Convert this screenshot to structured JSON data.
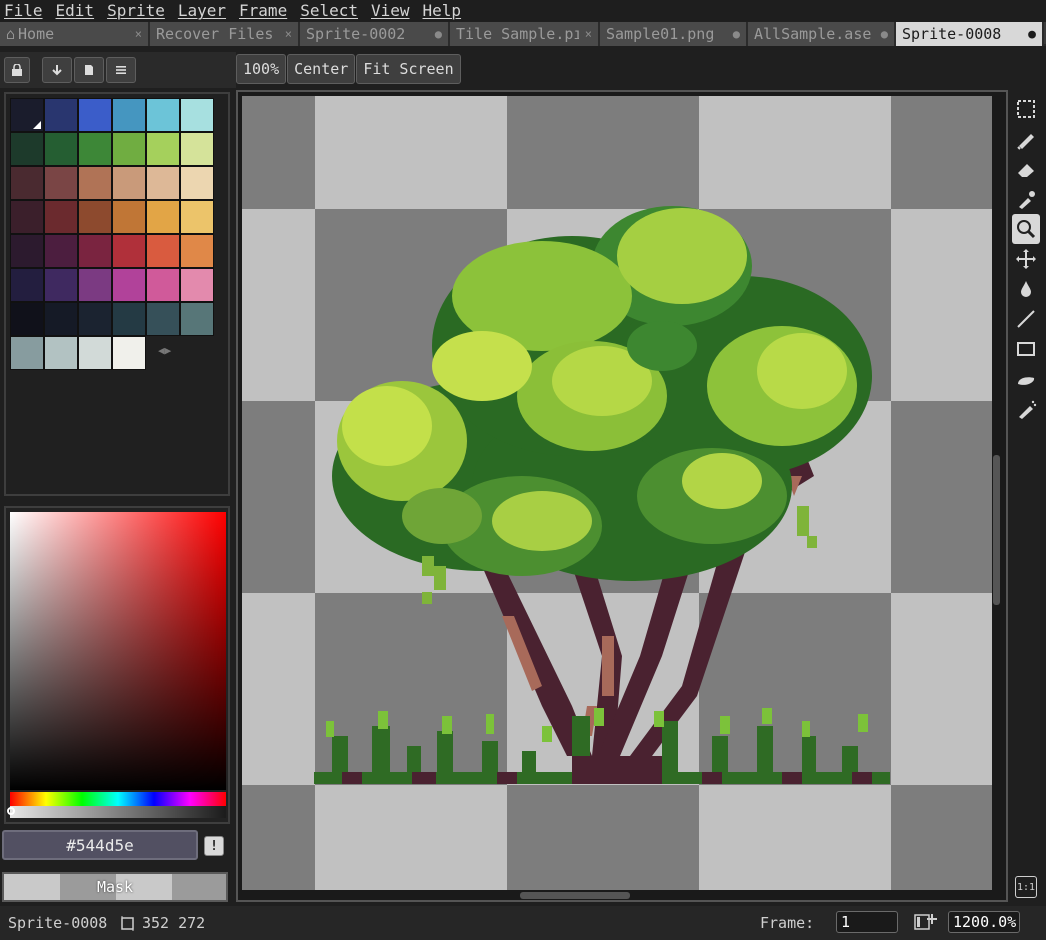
{
  "menu": [
    "File",
    "Edit",
    "Sprite",
    "Layer",
    "Frame",
    "Select",
    "View",
    "Help"
  ],
  "tabs": [
    {
      "label": "Home",
      "mark": "×",
      "width": 150
    },
    {
      "label": "Recover Files",
      "mark": "×",
      "width": 150
    },
    {
      "label": "Sprite-0002",
      "mark": "●",
      "width": 150
    },
    {
      "label": "Tile Sample.pı",
      "mark": "×",
      "width": 150
    },
    {
      "label": "Sample01.png",
      "mark": "●",
      "width": 148
    },
    {
      "label": "AllSample.ase",
      "mark": "●",
      "width": 148
    },
    {
      "label": "Sprite-0008",
      "mark": "●",
      "width": 148,
      "active": true
    }
  ],
  "palette": [
    "#1a1c2c",
    "#29366f",
    "#3b5dc9",
    "#4596c0",
    "#6cc4d8",
    "#a7e0e0",
    "#1d3a2b",
    "#255e32",
    "#3d8737",
    "#70ad41",
    "#a5d05c",
    "#d5e39a",
    "#4a2a30",
    "#7a4545",
    "#b07356",
    "#c99a7a",
    "#ddb897",
    "#ecd6b0",
    "#3b1f2b",
    "#6b2a2e",
    "#8d4a2e",
    "#c07636",
    "#e2a546",
    "#ecc46a",
    "#2c1a2e",
    "#4c1e3f",
    "#7a2440",
    "#b0303a",
    "#d95b3f",
    "#e08848",
    "#231e3f",
    "#3f2960",
    "#7b3a82",
    "#b1429a",
    "#d05a9a",
    "#e38aad",
    "#10111a",
    "#151a26",
    "#1b2330",
    "#243a44",
    "#365059",
    "#577678",
    "#879c9f",
    "#b2c2c2",
    "#d2dad8",
    "#f0f0eb"
  ],
  "color": {
    "hex": "#544d5e"
  },
  "mask_label": "Mask",
  "editor_buttons": [
    "100%",
    "Center",
    "Fit Screen"
  ],
  "status": {
    "sprite_name": "Sprite-0008",
    "size": "352 272",
    "frame_label": "Frame:",
    "frame_value": "1",
    "zoom": "1200.0%"
  },
  "tool_names": [
    "marquee",
    "pencil",
    "eraser",
    "eyedropper",
    "zoom",
    "move",
    "fill",
    "line",
    "rectangle",
    "blur",
    "spray"
  ],
  "one_to_one": "1:1"
}
